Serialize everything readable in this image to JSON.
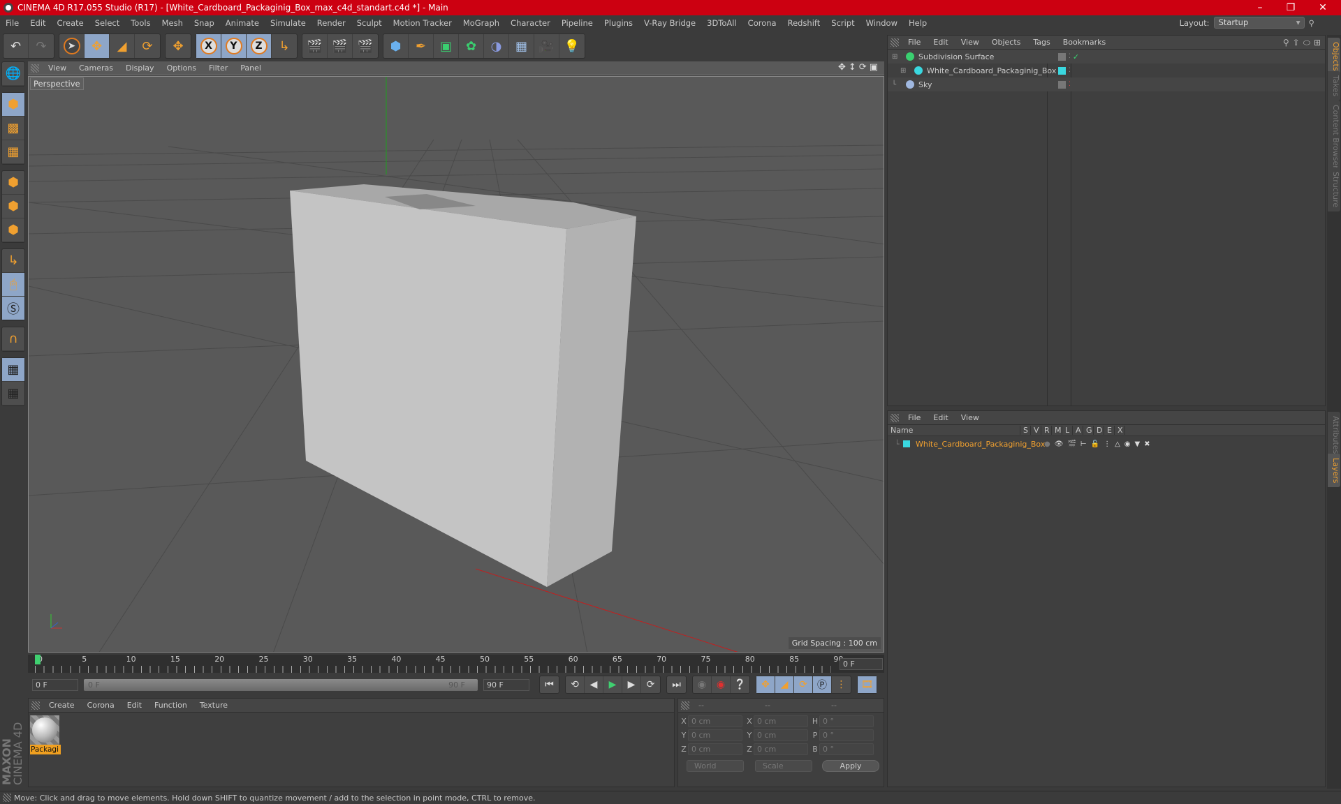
{
  "window": {
    "title": "CINEMA 4D R17.055 Studio (R17) - [White_Cardboard_Packaginig_Box_max_c4d_standart.c4d *] - Main",
    "controls": [
      "minimize",
      "restore",
      "close"
    ]
  },
  "menubar": [
    "File",
    "Edit",
    "Create",
    "Select",
    "Tools",
    "Mesh",
    "Snap",
    "Animate",
    "Simulate",
    "Render",
    "Sculpt",
    "Motion Tracker",
    "MoGraph",
    "Character",
    "Pipeline",
    "Plugins",
    "V-Ray Bridge",
    "3DToAll",
    "Corona",
    "Redshift",
    "Script",
    "Window",
    "Help"
  ],
  "layout": {
    "label": "Layout:",
    "value": "Startup"
  },
  "toolbar": {
    "groups": [
      [
        "undo-icon",
        "redo-icon"
      ],
      [
        "live-selection-icon",
        "move-icon",
        "scale-icon",
        "rotate-icon"
      ],
      [
        "move-alt-icon"
      ],
      [
        "x-axis-icon",
        "y-axis-icon",
        "z-axis-icon",
        "coordinate-system-icon"
      ],
      [
        "render-view-icon",
        "render-picture-viewer-icon",
        "render-settings-icon"
      ],
      [
        "cube-icon",
        "pen-icon",
        "subdivision-icon",
        "cloner-icon",
        "deformer-icon",
        "floor-icon",
        "camera-icon",
        "light-icon"
      ]
    ],
    "axis_labels": [
      "X",
      "Y",
      "Z"
    ]
  },
  "left_tools": [
    "model-mode-icon",
    "texture-mode-icon",
    "workplane-mode-icon",
    "points-mode-icon",
    "edges-mode-icon",
    "polygons-mode-icon",
    "axis-mode-icon",
    "tweak-mode-icon",
    "solo-mode-icon",
    "snap-icon",
    "workplane-lock-icon",
    "workplane-rotate-icon"
  ],
  "viewport": {
    "menu": [
      "View",
      "Cameras",
      "Display",
      "Options",
      "Filter",
      "Panel"
    ],
    "camera_label": "Perspective",
    "grid_spacing": "Grid Spacing : 100 cm",
    "nav_icons": [
      "pan-icon",
      "dolly-icon",
      "orbit-icon",
      "maximize-icon"
    ]
  },
  "timeline": {
    "ticks": [
      "0",
      "5",
      "10",
      "15",
      "20",
      "25",
      "30",
      "35",
      "40",
      "45",
      "50",
      "55",
      "60",
      "65",
      "70",
      "75",
      "80",
      "85",
      "90"
    ],
    "current_frame": "0 F",
    "start_field": "0 F",
    "range_start": "0 F",
    "range_end": "90 F",
    "end_field": "90 F"
  },
  "transport": [
    "go-to-start-icon",
    "prev-keyframe-icon",
    "prev-frame-icon",
    "play-icon",
    "next-frame-icon",
    "next-keyframe-icon",
    "go-to-end-icon"
  ],
  "material_panel": {
    "menu": [
      "Create",
      "Corona",
      "Edit",
      "Function",
      "Texture"
    ],
    "materials": [
      {
        "name": "Packagi"
      }
    ]
  },
  "brand": {
    "line1": "MAXON",
    "line2": "CINEMA 4D"
  },
  "coordinates": {
    "headers": [
      "--",
      "--",
      "--"
    ],
    "rows": [
      {
        "l1": "X",
        "v1": "0 cm",
        "l2": "X",
        "v2": "0 cm",
        "l3": "H",
        "v3": "0 °"
      },
      {
        "l1": "Y",
        "v1": "0 cm",
        "l2": "Y",
        "v2": "0 cm",
        "l3": "P",
        "v3": "0 °"
      },
      {
        "l1": "Z",
        "v1": "0 cm",
        "l2": "Z",
        "v2": "0 cm",
        "l3": "B",
        "v3": "0 °"
      }
    ],
    "space": "World",
    "mode": "Scale",
    "apply": "Apply"
  },
  "object_manager": {
    "menu": [
      "File",
      "Edit",
      "View",
      "Objects",
      "Tags",
      "Bookmarks"
    ],
    "objects": [
      {
        "name": "Subdivision Surface",
        "icon": "subdivision-icon",
        "color": "#3ad070",
        "indent": 0
      },
      {
        "name": "White_Cardboard_Packaginig_Box",
        "icon": "null-object-icon",
        "color": "#3ad8e0",
        "indent": 1
      },
      {
        "name": "Sky",
        "icon": "sky-icon",
        "color": "#a0b8e0",
        "indent": 0
      }
    ]
  },
  "layer_manager": {
    "menu": [
      "File",
      "Edit",
      "View"
    ],
    "columns": [
      "Name",
      "S",
      "V",
      "R",
      "M",
      "L",
      "A",
      "G",
      "D",
      "E",
      "X"
    ],
    "layers": [
      {
        "name": "White_Cardboard_Packaginig_Box",
        "color": "#3ad8e0"
      }
    ]
  },
  "side_tabs": {
    "top": [
      "Objects",
      "Takes",
      "Content Browser",
      "Structure"
    ],
    "bottom": [
      "Attributes",
      "Layers"
    ]
  },
  "status": "Move: Click and drag to move elements. Hold down SHIFT to quantize movement / add to the selection in point mode, CTRL to remove.",
  "colors": {
    "titlebar": "#cc0011",
    "accent": "#f0a030",
    "active_button": "#8ea6c8"
  }
}
